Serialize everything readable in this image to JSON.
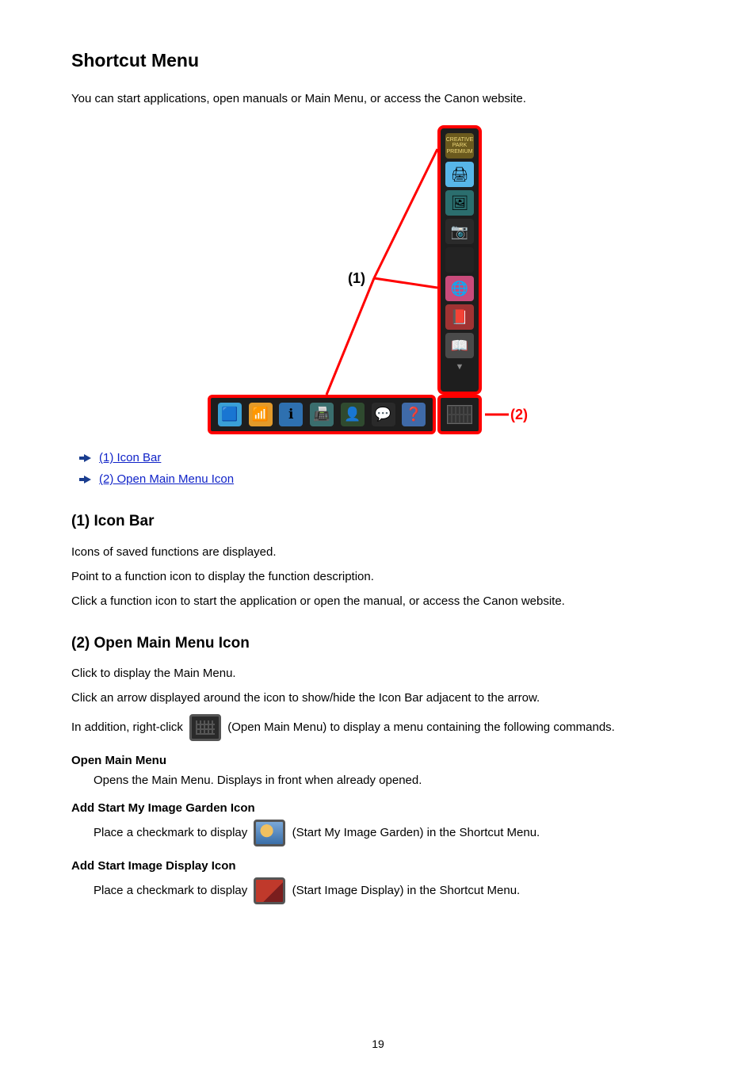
{
  "title": "Shortcut Menu",
  "intro": "You can start applications, open manuals or Main Menu, or access the Canon website.",
  "figure": {
    "annot1": "(1)",
    "annot2": "(2)",
    "v_gold_label": "CREATIVE PARK PREMIUM"
  },
  "links": {
    "item1": "(1) Icon Bar",
    "item2": "(2) Open Main Menu Icon"
  },
  "section1": {
    "heading": "(1) Icon Bar",
    "p1": "Icons of saved functions are displayed.",
    "p2": "Point to a function icon to display the function description.",
    "p3": "Click a function icon to start the application or open the manual, or access the Canon website."
  },
  "section2": {
    "heading": "(2) Open Main Menu Icon",
    "p1": "Click to display the Main Menu.",
    "p2": "Click an arrow displayed around the icon to show/hide the Icon Bar adjacent to the arrow.",
    "p3_pre": "In addition, right-click ",
    "p3_post": " (Open Main Menu) to display a menu containing the following commands.",
    "dl": {
      "d1_t": "Open Main Menu",
      "d1_d": "Opens the Main Menu. Displays in front when already opened.",
      "d2_t": "Add Start My Image Garden Icon",
      "d2_pre": "Place a checkmark to display ",
      "d2_post": " (Start My Image Garden) in the Shortcut Menu.",
      "d3_t": "Add Start Image Display Icon",
      "d3_pre": "Place a checkmark to display ",
      "d3_post": " (Start Image Display) in the Shortcut Menu."
    }
  },
  "page_number": "19"
}
